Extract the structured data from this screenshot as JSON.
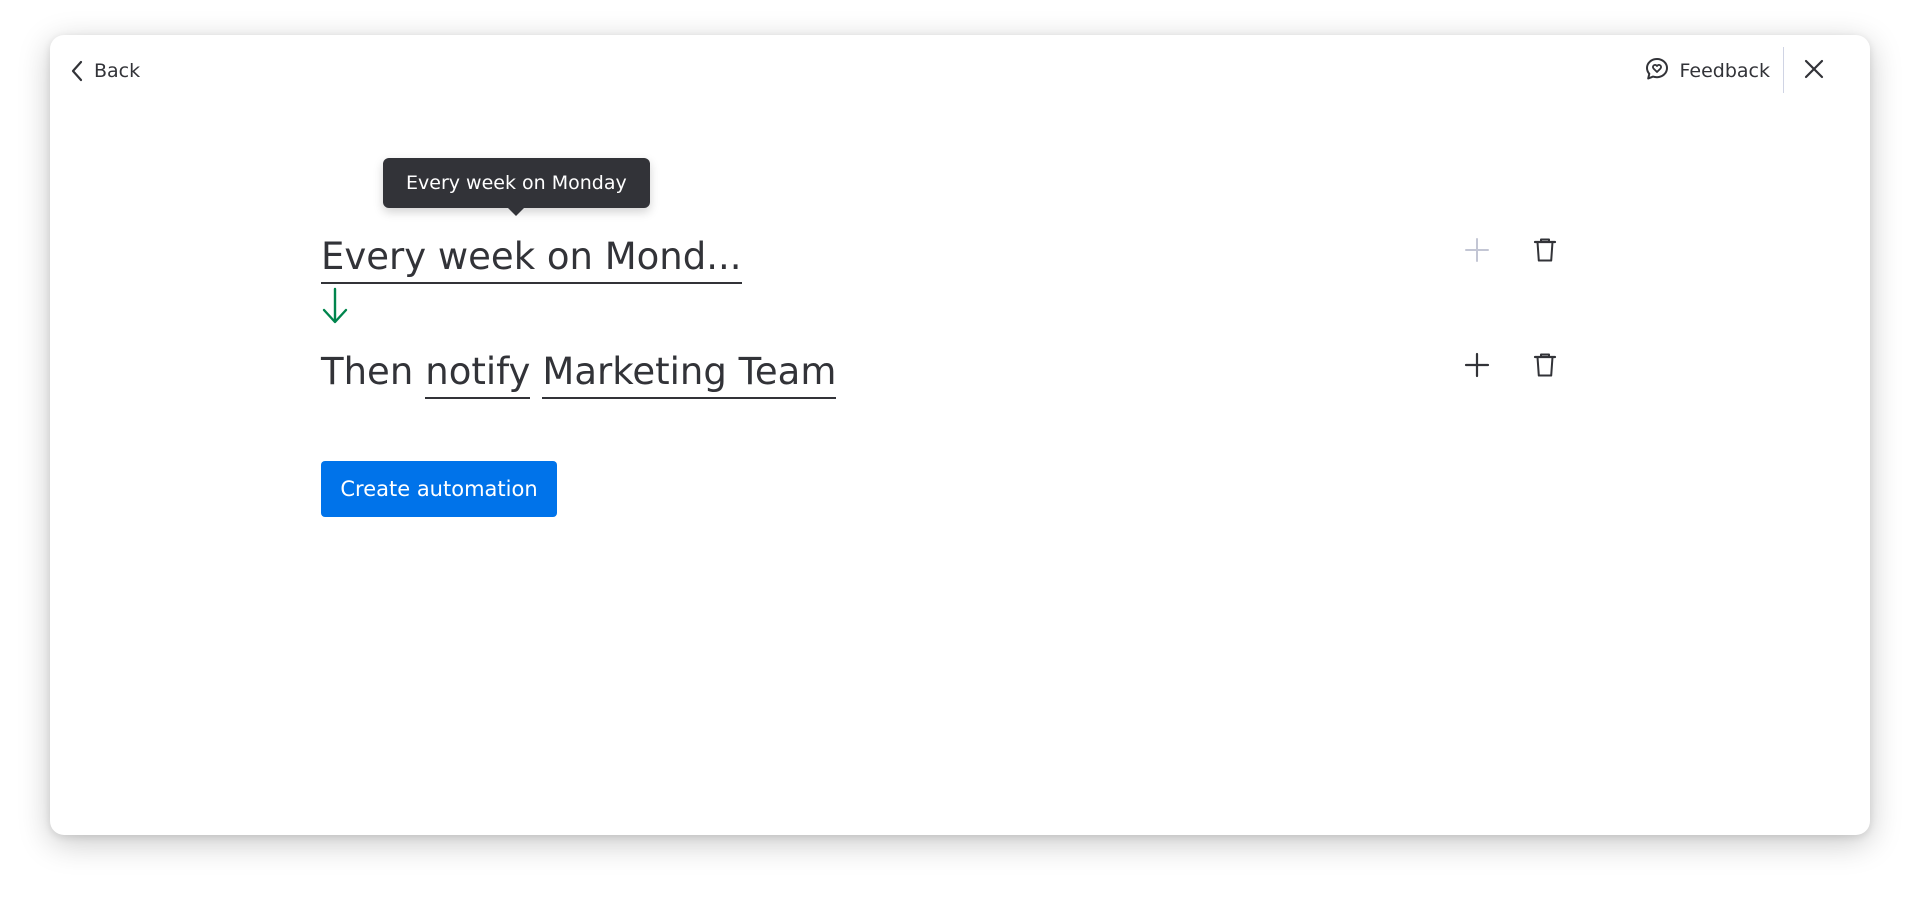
{
  "header": {
    "back_label": "Back",
    "feedback_label": "Feedback"
  },
  "tooltip": {
    "text": "Every week on Monday"
  },
  "recipe": {
    "trigger": {
      "text": "Every week on Mond..."
    },
    "action": {
      "prefix": "Then",
      "verb": "notify",
      "target": "Marketing Team"
    }
  },
  "footer": {
    "create_label": "Create automation"
  },
  "colors": {
    "primary": "#0073ea",
    "flow_arrow": "#00854d",
    "text": "#323338",
    "tooltip_bg": "#323338",
    "disabled_icon": "#c3c6d4"
  },
  "icons": {
    "back": "chevron-left-icon",
    "feedback": "chat-heart-icon",
    "close": "close-icon",
    "flow": "arrow-down-icon",
    "add": "plus-icon",
    "delete": "trash-icon"
  }
}
